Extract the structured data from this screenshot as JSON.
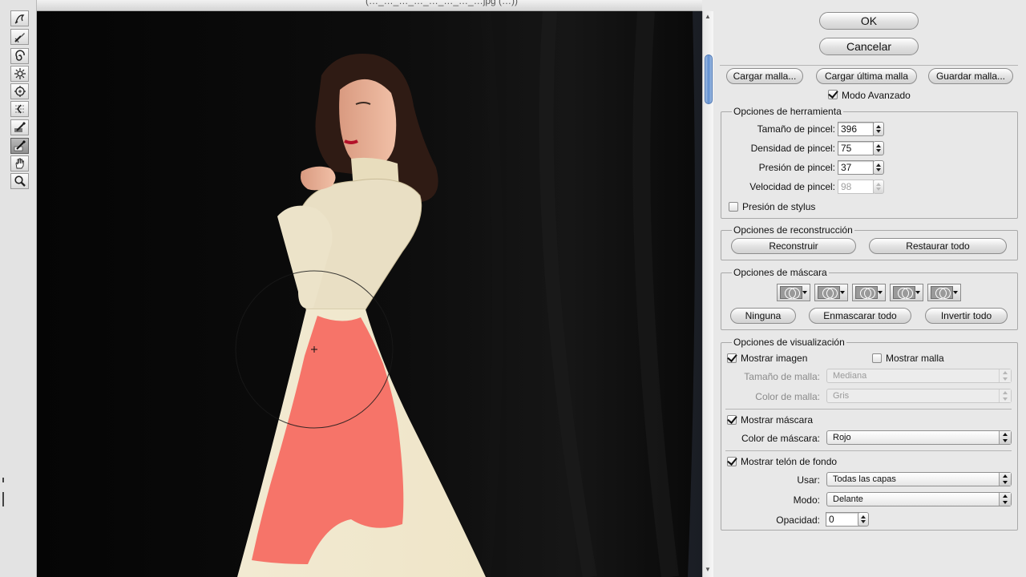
{
  "window": {
    "title": "(…_…_…_…_…_…_…_…jpg (…))"
  },
  "toolbar": {
    "tools": [
      {
        "name": "forward-warp-icon"
      },
      {
        "name": "reconstruct-brush-icon"
      },
      {
        "name": "twirl-icon"
      },
      {
        "name": "pucker-icon"
      },
      {
        "name": "bloat-icon"
      },
      {
        "name": "push-left-icon"
      },
      {
        "name": "freeze-mask-icon"
      },
      {
        "name": "thaw-mask-icon"
      },
      {
        "name": "hand-icon"
      },
      {
        "name": "zoom-icon"
      }
    ]
  },
  "dialog": {
    "ok_label": "OK",
    "cancel_label": "Cancelar",
    "load_mesh_label": "Cargar malla...",
    "load_last_mesh_label": "Cargar última malla",
    "save_mesh_label": "Guardar malla...",
    "advanced_mode_label": "Modo Avanzado"
  },
  "tool_options": {
    "title": "Opciones de herramienta",
    "brush_size_label": "Tamaño de pincel:",
    "brush_size_value": "396",
    "brush_density_label": "Densidad de pincel:",
    "brush_density_value": "75",
    "brush_pressure_label": "Presión de pincel:",
    "brush_pressure_value": "37",
    "brush_rate_label": "Velocidad de pincel:",
    "brush_rate_value": "98",
    "stylus_pressure_label": "Presión de stylus"
  },
  "reconstruct_options": {
    "title": "Opciones de reconstrucción",
    "reconstruct_label": "Reconstruir",
    "restore_all_label": "Restaurar todo"
  },
  "mask_options": {
    "title": "Opciones de máscara",
    "none_label": "Ninguna",
    "mask_all_label": "Enmascarar todo",
    "invert_all_label": "Invertir todo"
  },
  "view_options": {
    "title": "Opciones de visualización",
    "show_image_label": "Mostrar imagen",
    "show_mesh_label": "Mostrar malla",
    "mesh_size_label": "Tamaño de malla:",
    "mesh_size_value": "Mediana",
    "mesh_color_label": "Color de malla:",
    "mesh_color_value": "Gris",
    "show_mask_label": "Mostrar máscara",
    "mask_color_label": "Color de máscara:",
    "mask_color_value": "Rojo",
    "show_backdrop_label": "Mostrar telón de fondo",
    "use_label": "Usar:",
    "use_value": "Todas las capas",
    "mode_label": "Modo:",
    "mode_value": "Delante",
    "opacity_label": "Opacidad:",
    "opacity_value": "0"
  },
  "colors": {
    "mask_overlay": "#f56e63",
    "backdrop": "#070707",
    "scroll_thumb": "#5f8ed1"
  }
}
